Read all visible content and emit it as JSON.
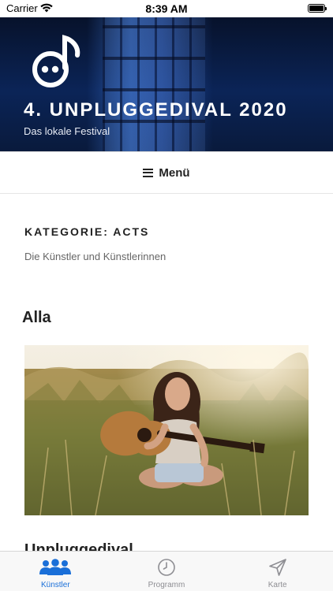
{
  "status_bar": {
    "carrier": "Carrier",
    "time": "8:39 AM",
    "icons": [
      "wifi-icon",
      "battery-icon"
    ]
  },
  "header": {
    "title": "4. UNPLUGGEDIVAL 2020",
    "subtitle": "Das lokale Festival",
    "logo_icon": "music-note-face-logo"
  },
  "menu": {
    "label": "Menü",
    "icon": "hamburger-icon"
  },
  "category": {
    "title": "KATEGORIE: ACTS",
    "description": "Die Künstler und Künstlerinnen"
  },
  "posts": [
    {
      "title": "Alla",
      "image": "artist-photo-guitar-field"
    },
    {
      "title": "Unpluggedival"
    }
  ],
  "tabbar": {
    "accent_color": "#1a6fd8",
    "inactive_color": "#8e8e93",
    "tabs": [
      {
        "label": "Künstler",
        "icon": "people-icon",
        "active": true
      },
      {
        "label": "Programm",
        "icon": "clock-icon",
        "active": false
      },
      {
        "label": "Karte",
        "icon": "navigation-arrow-icon",
        "active": false
      }
    ]
  }
}
